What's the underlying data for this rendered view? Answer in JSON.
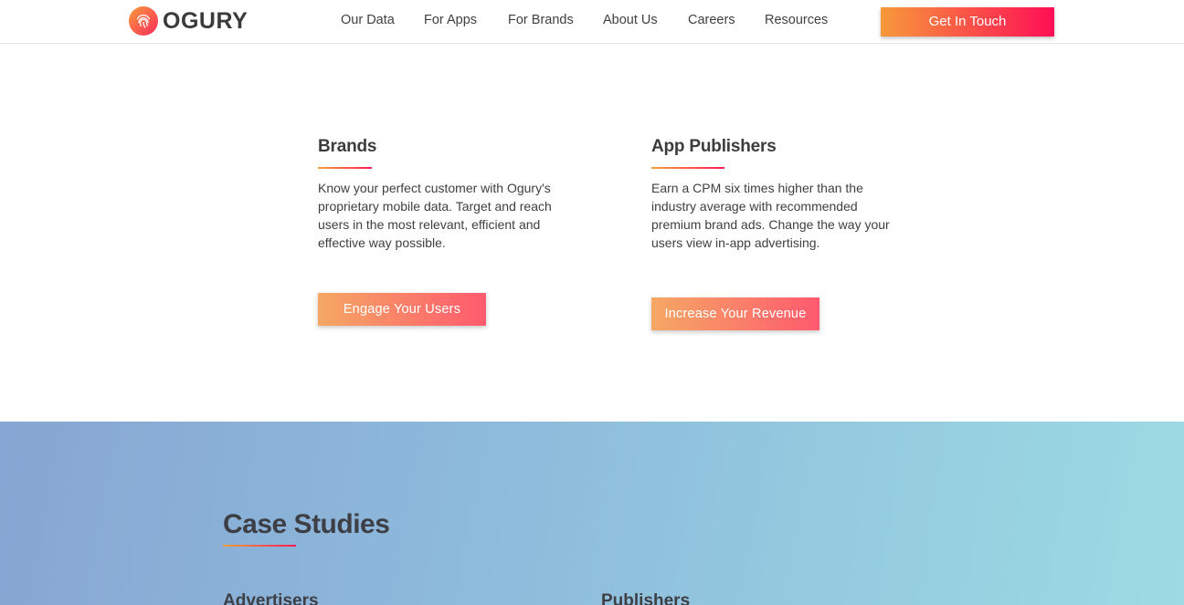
{
  "header": {
    "logo_text": "OGURY",
    "nav": [
      "Our Data",
      "For Apps",
      "For Brands",
      "About Us",
      "Careers",
      "Resources"
    ],
    "cta_label": "Get In Touch"
  },
  "features": [
    {
      "title": "Brands",
      "description": "Know your perfect customer with Ogury's proprietary mobile data. Target and reach users in the most relevant, efficient and effective way possible.",
      "button_label": "Engage Your Users"
    },
    {
      "title": "App Publishers",
      "description": "Earn a CPM six times higher than the industry average with recommended premium brand ads. Change the way your users view in-app advertising.",
      "button_label": "Increase Your Revenue"
    }
  ],
  "case_studies": {
    "title": "Case Studies",
    "columns": [
      "Advertisers",
      "Publishers"
    ]
  },
  "icons": {
    "logo": "fingerprint-icon"
  },
  "colors": {
    "accent_start": "#f6993b",
    "accent_end": "#ff0e55",
    "case_bg_start": "#87a6d3",
    "case_bg_end": "#9cdbe3"
  }
}
